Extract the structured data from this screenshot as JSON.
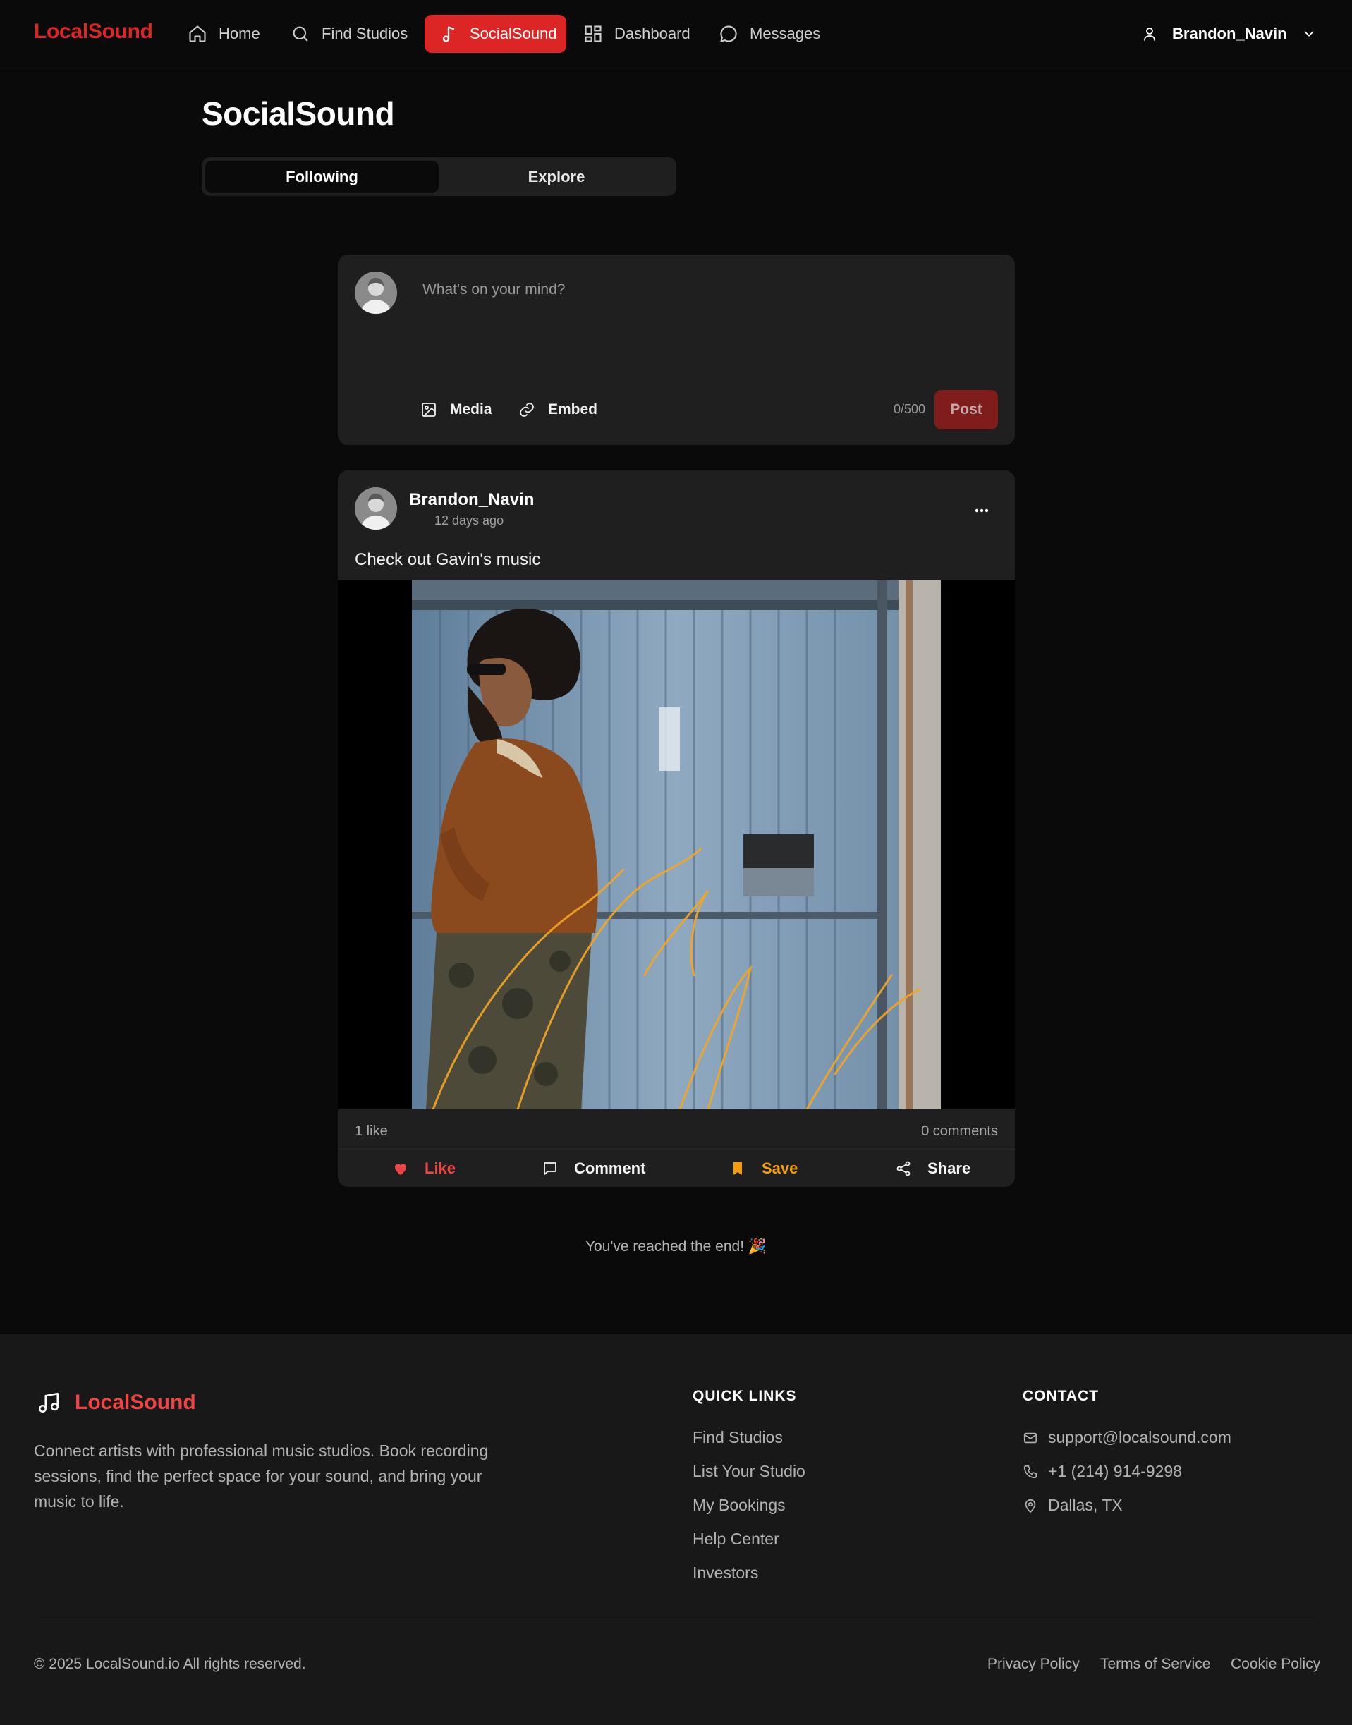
{
  "nav": {
    "brand": "LocalSound",
    "items": [
      {
        "label": "Home",
        "icon": "home-icon"
      },
      {
        "label": "Find Studios",
        "icon": "search-icon"
      },
      {
        "label": "SocialSound",
        "icon": "music-note-icon",
        "active": true
      },
      {
        "label": "Dashboard",
        "icon": "grid-icon"
      },
      {
        "label": "Messages",
        "icon": "chat-bubble-icon"
      }
    ],
    "user": {
      "name": "Brandon_Navin",
      "icon": "user-icon"
    }
  },
  "page": {
    "title": "SocialSound",
    "tabs": [
      {
        "label": "Following",
        "active": true
      },
      {
        "label": "Explore",
        "active": false
      }
    ]
  },
  "composer": {
    "placeholder": "What's on your mind?",
    "media_label": "Media",
    "embed_label": "Embed",
    "char_count": "0/500",
    "post_label": "Post"
  },
  "post": {
    "author": "Brandon_Navin",
    "time": "12 days ago",
    "text": "Check out Gavin's music",
    "likes": "1 like",
    "comments": "0 comments",
    "actions": {
      "like": "Like",
      "comment": "Comment",
      "save": "Save",
      "share": "Share"
    }
  },
  "end_message": "You've reached the end! 🎉",
  "footer": {
    "brand": "LocalSound",
    "description": "Connect artists with professional music studios. Book recording sessions, find the perfect space for your sound, and bring your music to life.",
    "quick_links_heading": "QUICK LINKS",
    "quick_links": [
      "Find Studios",
      "List Your Studio",
      "My Bookings",
      "Help Center",
      "Investors"
    ],
    "contact_heading": "CONTACT",
    "contact": {
      "email": "support@localsound.com",
      "phone": "+1 (214) 914-9298",
      "location": "Dallas, TX"
    },
    "copyright": "© 2025 LocalSound.io All rights reserved.",
    "legal": [
      "Privacy Policy",
      "Terms of Service",
      "Cookie Policy"
    ]
  },
  "colors": {
    "accent": "#dc2626",
    "background": "#0a0a0a",
    "card": "#1f1f1f",
    "save": "#f59e0b"
  }
}
